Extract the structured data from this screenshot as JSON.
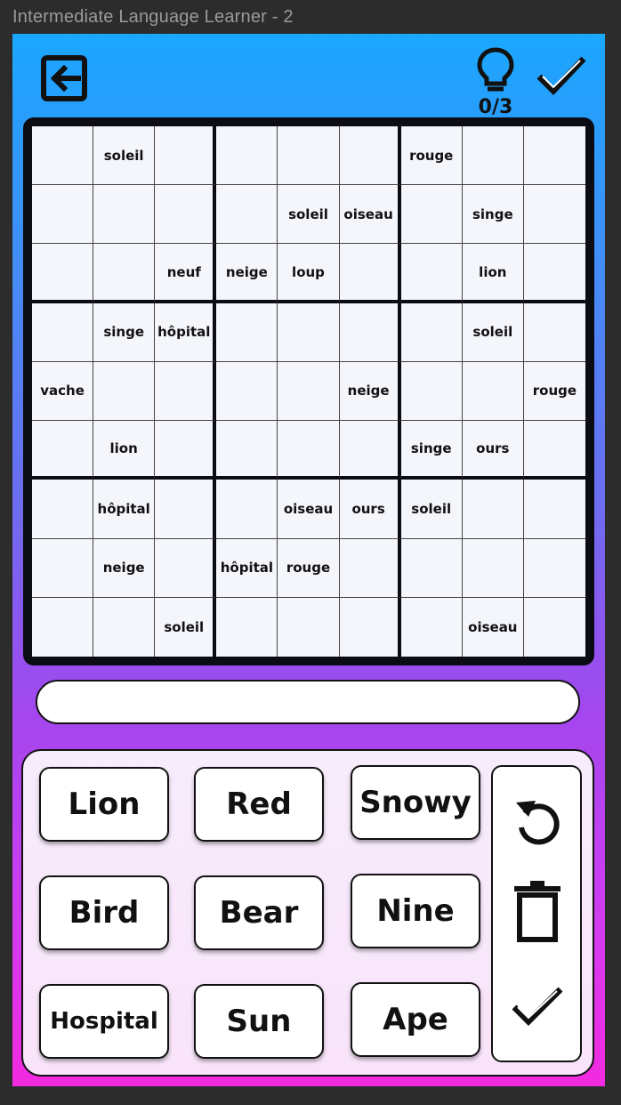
{
  "window": {
    "title": "Intermediate Language Learner - 2"
  },
  "toolbar": {
    "exit_icon": "exit-arrow-icon",
    "hint_icon": "lightbulb-icon",
    "hint_count": "0/3",
    "check_icon": "checkmark-icon"
  },
  "board": {
    "rows": [
      [
        "",
        "soleil",
        "",
        "",
        "",
        "",
        "rouge",
        "",
        ""
      ],
      [
        "",
        "",
        "",
        "",
        "soleil",
        "oiseau",
        "",
        "singe",
        ""
      ],
      [
        "",
        "",
        "neuf",
        "neige",
        "loup",
        "",
        "",
        "lion",
        ""
      ],
      [
        "",
        "singe",
        "hôpital",
        "",
        "",
        "",
        "",
        "soleil",
        ""
      ],
      [
        "vache",
        "",
        "",
        "",
        "",
        "neige",
        "",
        "",
        "rouge"
      ],
      [
        "",
        "lion",
        "",
        "",
        "",
        "",
        "singe",
        "ours",
        ""
      ],
      [
        "",
        "hôpital",
        "",
        "",
        "oiseau",
        "ours",
        "soleil",
        "",
        ""
      ],
      [
        "",
        "neige",
        "",
        "hôpital",
        "rouge",
        "",
        "",
        "",
        ""
      ],
      [
        "",
        "",
        "soleil",
        "",
        "",
        "",
        "",
        "oiseau",
        ""
      ]
    ]
  },
  "answer": {
    "value": ""
  },
  "words": {
    "w0": "Lion",
    "w1": "Red",
    "w2": "Snowy",
    "w3": "Bird",
    "w4": "Bear",
    "w5": "Nine",
    "w6": "Hospital",
    "w7": "Sun",
    "w8": "Ape"
  },
  "actions": {
    "undo_icon": "undo-icon",
    "delete_icon": "trash-icon",
    "confirm_icon": "checkmark-icon"
  },
  "colors": {
    "gradient_top": "#1aa7ff",
    "gradient_bottom": "#f22ae0",
    "board": "#0c0c14",
    "cell": "#f4f6fc"
  }
}
